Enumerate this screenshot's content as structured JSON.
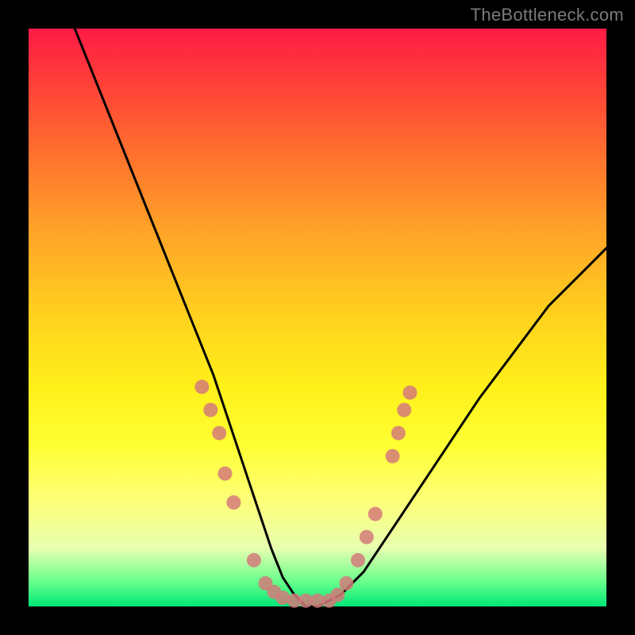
{
  "watermark": "TheBottleneck.com",
  "chart_data": {
    "type": "line",
    "title": "",
    "xlabel": "",
    "ylabel": "",
    "xlim": [
      0,
      100
    ],
    "ylim": [
      0,
      100
    ],
    "grid": false,
    "series": [
      {
        "name": "bottleneck-curve",
        "color": "#000000",
        "x": [
          8,
          12,
          16,
          20,
          24,
          28,
          32,
          36,
          38,
          40,
          42,
          44,
          46,
          48,
          50,
          54,
          58,
          62,
          66,
          70,
          74,
          78,
          84,
          90,
          96,
          100
        ],
        "y": [
          100,
          90,
          80,
          70,
          60,
          50,
          40,
          28,
          22,
          16,
          10,
          5,
          2,
          0,
          0,
          2,
          6,
          12,
          18,
          24,
          30,
          36,
          44,
          52,
          58,
          62
        ]
      }
    ],
    "markers": [
      {
        "name": "highlight-dots",
        "color": "#d47a7a",
        "r": 9,
        "points": [
          {
            "x": 30.0,
            "y": 38.0
          },
          {
            "x": 31.5,
            "y": 34.0
          },
          {
            "x": 33.0,
            "y": 30.0
          },
          {
            "x": 34.0,
            "y": 23.0
          },
          {
            "x": 35.5,
            "y": 18.0
          },
          {
            "x": 39.0,
            "y": 8.0
          },
          {
            "x": 41.0,
            "y": 4.0
          },
          {
            "x": 42.5,
            "y": 2.5
          },
          {
            "x": 44.0,
            "y": 1.5
          },
          {
            "x": 46.0,
            "y": 1.0
          },
          {
            "x": 48.0,
            "y": 1.0
          },
          {
            "x": 50.0,
            "y": 1.0
          },
          {
            "x": 52.0,
            "y": 1.0
          },
          {
            "x": 53.5,
            "y": 2.0
          },
          {
            "x": 55.0,
            "y": 4.0
          },
          {
            "x": 57.0,
            "y": 8.0
          },
          {
            "x": 58.5,
            "y": 12.0
          },
          {
            "x": 60.0,
            "y": 16.0
          },
          {
            "x": 63.0,
            "y": 26.0
          },
          {
            "x": 64.0,
            "y": 30.0
          },
          {
            "x": 65.0,
            "y": 34.0
          },
          {
            "x": 66.0,
            "y": 37.0
          }
        ]
      }
    ],
    "background_gradient": {
      "top": "#ff1a46",
      "mid": "#ffff33",
      "bottom": "#00e676"
    }
  }
}
